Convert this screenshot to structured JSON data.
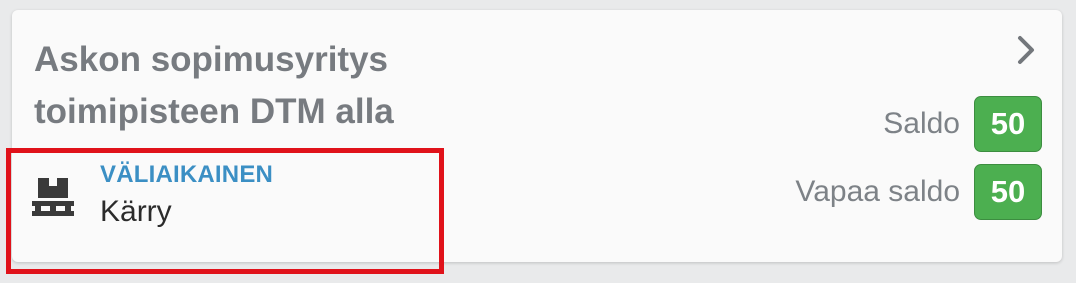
{
  "card": {
    "title": "Askon sopimusyritys toimipisteen DTM alla",
    "chevron_icon": "chevron-right-icon"
  },
  "product": {
    "icon": "pallet-icon",
    "status": "VÄLIAIKAINEN",
    "name": "Kärry"
  },
  "balances": [
    {
      "label": "Saldo",
      "value": "50"
    },
    {
      "label": "Vapaa saldo",
      "value": "50"
    }
  ],
  "colors": {
    "status_text": "#3b8fc4",
    "badge_bg": "#4caf50",
    "highlight_border": "#e0121a",
    "title_text": "#777b80"
  }
}
